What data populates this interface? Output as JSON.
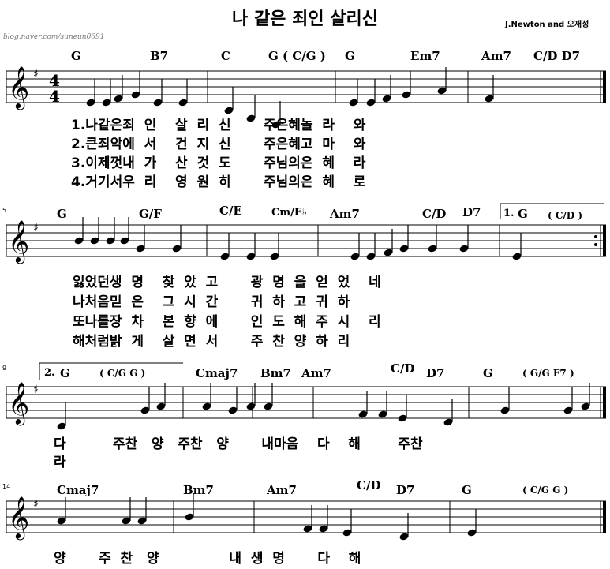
{
  "title": "나 같은 죄인 살리신",
  "composer": "J.Newton and 오재성",
  "blog": "blog.naver.com/suneun0691",
  "measure_numbers": [
    "5",
    "9",
    "14"
  ],
  "time_sig": [
    "4",
    "4"
  ],
  "ending1": "1.",
  "ending2": "2.",
  "system1": {
    "chords": [
      "G",
      "B7",
      "C",
      "G ( C/G )",
      "G",
      "Em7",
      "Am7",
      "C/D D7"
    ],
    "lyrics": [
      "1.나같은죄  인    살  리  신       주은혜놀  라    와",
      "2.큰죄악에  서    건  지  신       주은혜고  마    와",
      "3.이제껏내  가    산  것  도       주님의은  혜    라",
      "4.거기서우  리    영  원  히       주님의은  혜    로"
    ]
  },
  "system2": {
    "chords": [
      "G",
      "G/F",
      "C/E",
      "Cm/E♭",
      "Am7",
      "C/D",
      "D7",
      "G",
      "( C/D )"
    ],
    "lyrics": [
      "잃었던생  명    찾  았  고       광  명  을  얻  었    네",
      "나처음믿  은    그  시  간       귀  하  고  귀  하",
      "또나를장  차    본  향  에       인  도  해  주  시    리",
      "해처럼밝  게    살  면  서       주  찬  양  하  리"
    ]
  },
  "system3": {
    "chords": [
      "G",
      "( C/G G )",
      "Cmaj7",
      "Bm7",
      "Am7",
      "C/D",
      "D7",
      "G",
      "( G/G F7 )"
    ],
    "lyrics": [
      "다          주찬   양   주찬   양       내마음    다    해        주찬",
      "라"
    ]
  },
  "system4": {
    "chords": [
      "Cmaj7",
      "Bm7",
      "Am7",
      "C/D",
      "D7",
      "G",
      "( C/G G )"
    ],
    "lyrics": [
      "양       주  찬   양               내  생  명       다    해"
    ]
  }
}
